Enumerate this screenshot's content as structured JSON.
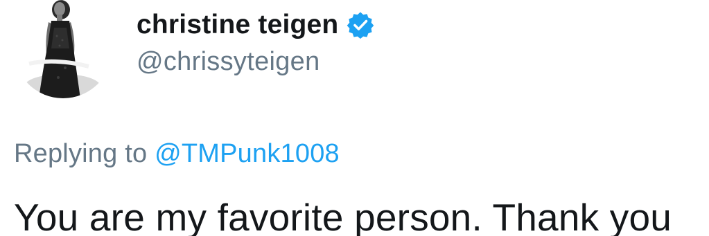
{
  "author": {
    "display_name": "christine teigen",
    "handle": "@chrissyteigen",
    "verified": true,
    "avatar_icon": "profile-photo"
  },
  "reply": {
    "prefix": "Replying to",
    "target": "@TMPunk1008"
  },
  "tweet": {
    "text": "You are my favorite person. Thank you"
  },
  "colors": {
    "name": "#14171a",
    "secondary": "#657786",
    "link": "#1da1f2",
    "verified_badge": "#1da1f2"
  }
}
